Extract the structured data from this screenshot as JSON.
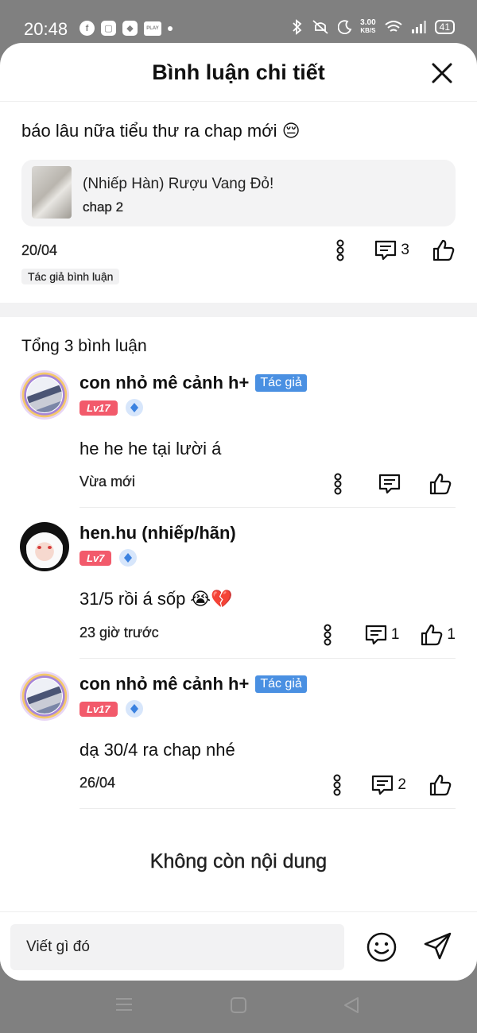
{
  "status_bar": {
    "time": "20:48",
    "net_speed_value": "3.00",
    "net_speed_unit": "KB/S",
    "battery": "41",
    "play_label": "PLAY"
  },
  "sheet": {
    "title": "Bình luận chi tiết"
  },
  "top_comment": {
    "text": "báo lâu nữa tiểu thư ra chap mới 😔",
    "reference": {
      "title": "(Nhiếp Hàn) Rượu Vang Đỏ!",
      "chapter": "chap 2"
    },
    "date": "20/04",
    "reply_count": "3",
    "author_tag": "Tác giả bình luận"
  },
  "total_label": "Tổng 3 bình luận",
  "comments": [
    {
      "name": "con nhỏ mê cảnh h+",
      "tag": "Tác giả",
      "level": "Lv17",
      "text": "he he he tại lười á",
      "time": "Vừa mới",
      "reply_count": "",
      "like_count": ""
    },
    {
      "name": "hen.hu (nhiếp/hãn)",
      "tag": "",
      "level": "Lv7",
      "text": "31/5 rồi á sốp 😭💔",
      "time": "23 giờ trước",
      "reply_count": "1",
      "like_count": "1"
    },
    {
      "name": "con nhỏ mê cảnh h+",
      "tag": "Tác giả",
      "level": "Lv17",
      "text": "dạ 30/4 ra chap nhé",
      "time": "26/04",
      "reply_count": "2",
      "like_count": ""
    }
  ],
  "end_label": "Không còn nội dung",
  "input": {
    "placeholder": "Viết gì đó"
  },
  "colors": {
    "author_tag": "#4a90e2",
    "level_badge": "#f25a6b",
    "system_bar": "#808080"
  },
  "icons": [
    "close-icon",
    "more-icon",
    "reply-icon",
    "like-icon",
    "emoji-icon",
    "send-icon",
    "menu-nav-icon",
    "home-nav-icon",
    "back-nav-icon"
  ]
}
